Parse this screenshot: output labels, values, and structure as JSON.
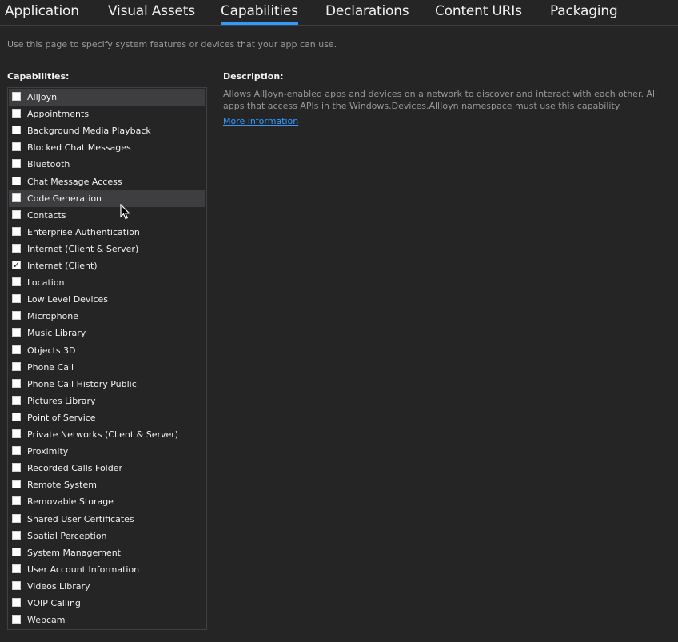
{
  "tabs": [
    {
      "label": "Application",
      "active": false
    },
    {
      "label": "Visual Assets",
      "active": false
    },
    {
      "label": "Capabilities",
      "active": true
    },
    {
      "label": "Declarations",
      "active": false
    },
    {
      "label": "Content URIs",
      "active": false
    },
    {
      "label": "Packaging",
      "active": false
    }
  ],
  "intro": "Use this page to specify system features or devices that your app can use.",
  "capabilities_heading": "Capabilities:",
  "description_heading": "Description:",
  "description_text": "Allows AllJoyn-enabled apps and devices on a network to discover and interact with each other. All apps that access APIs in the Windows.Devices.AllJoyn namespace must use this capability.",
  "more_info": "More information",
  "accent_color": "#3399ff",
  "capabilities": [
    {
      "label": "AllJoyn",
      "checked": false,
      "highlighted": true
    },
    {
      "label": "Appointments",
      "checked": false,
      "highlighted": false
    },
    {
      "label": "Background Media Playback",
      "checked": false,
      "highlighted": false
    },
    {
      "label": "Blocked Chat Messages",
      "checked": false,
      "highlighted": false
    },
    {
      "label": "Bluetooth",
      "checked": false,
      "highlighted": false
    },
    {
      "label": "Chat Message Access",
      "checked": false,
      "highlighted": false
    },
    {
      "label": "Code Generation",
      "checked": false,
      "highlighted": true
    },
    {
      "label": "Contacts",
      "checked": false,
      "highlighted": false
    },
    {
      "label": "Enterprise Authentication",
      "checked": false,
      "highlighted": false
    },
    {
      "label": "Internet (Client & Server)",
      "checked": false,
      "highlighted": false
    },
    {
      "label": "Internet (Client)",
      "checked": true,
      "highlighted": false
    },
    {
      "label": "Location",
      "checked": false,
      "highlighted": false
    },
    {
      "label": "Low Level Devices",
      "checked": false,
      "highlighted": false
    },
    {
      "label": "Microphone",
      "checked": false,
      "highlighted": false
    },
    {
      "label": "Music Library",
      "checked": false,
      "highlighted": false
    },
    {
      "label": "Objects 3D",
      "checked": false,
      "highlighted": false
    },
    {
      "label": "Phone Call",
      "checked": false,
      "highlighted": false
    },
    {
      "label": "Phone Call History Public",
      "checked": false,
      "highlighted": false
    },
    {
      "label": "Pictures Library",
      "checked": false,
      "highlighted": false
    },
    {
      "label": "Point of Service",
      "checked": false,
      "highlighted": false
    },
    {
      "label": "Private Networks (Client & Server)",
      "checked": false,
      "highlighted": false
    },
    {
      "label": "Proximity",
      "checked": false,
      "highlighted": false
    },
    {
      "label": "Recorded Calls Folder",
      "checked": false,
      "highlighted": false
    },
    {
      "label": "Remote System",
      "checked": false,
      "highlighted": false
    },
    {
      "label": "Removable Storage",
      "checked": false,
      "highlighted": false
    },
    {
      "label": "Shared User Certificates",
      "checked": false,
      "highlighted": false
    },
    {
      "label": "Spatial Perception",
      "checked": false,
      "highlighted": false
    },
    {
      "label": "System Management",
      "checked": false,
      "highlighted": false
    },
    {
      "label": "User Account Information",
      "checked": false,
      "highlighted": false
    },
    {
      "label": "Videos Library",
      "checked": false,
      "highlighted": false
    },
    {
      "label": "VOIP Calling",
      "checked": false,
      "highlighted": false
    },
    {
      "label": "Webcam",
      "checked": false,
      "highlighted": false
    }
  ]
}
